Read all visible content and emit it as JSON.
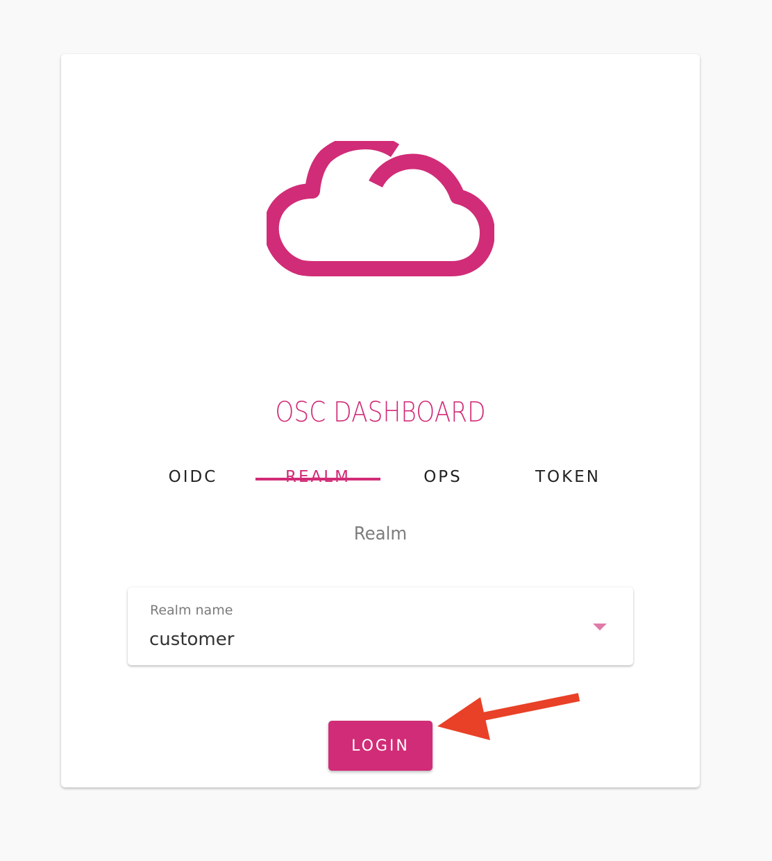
{
  "app": {
    "title": "OSC DASHBOARD",
    "logo_icon": "cloud-icon",
    "accent_color": "#d12c77"
  },
  "tabs": [
    {
      "label": "OIDC",
      "active": false
    },
    {
      "label": "REALM",
      "active": true
    },
    {
      "label": "OPS",
      "active": false
    },
    {
      "label": "TOKEN",
      "active": false
    }
  ],
  "realm_section": {
    "heading": "Realm",
    "select": {
      "label": "Realm name",
      "value": "customer",
      "caret_icon": "caret-down-icon"
    }
  },
  "actions": {
    "login_label": "LOGIN"
  },
  "annotation": {
    "arrow_icon": "arrow-left-icon",
    "arrow_color": "#e84127"
  }
}
